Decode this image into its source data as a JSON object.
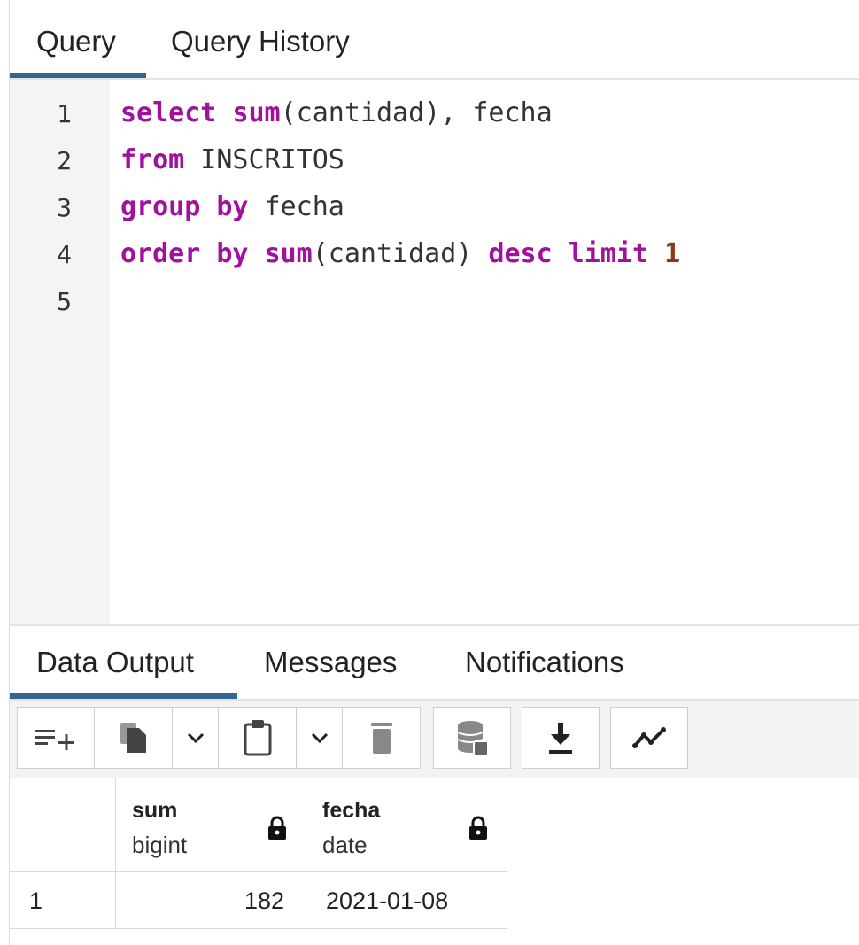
{
  "editor_tabs": [
    {
      "label": "Query",
      "active": true
    },
    {
      "label": "Query History",
      "active": false
    }
  ],
  "editor": {
    "line_numbers": [
      "1",
      "2",
      "3",
      "4",
      "5"
    ],
    "lines": [
      [
        {
          "t": "select",
          "c": "kw"
        },
        {
          "t": " "
        },
        {
          "t": "sum",
          "c": "fn"
        },
        {
          "t": "(cantidad), fecha"
        }
      ],
      [
        {
          "t": "from",
          "c": "kw"
        },
        {
          "t": " INSCRITOS"
        }
      ],
      [
        {
          "t": "group by",
          "c": "kw"
        },
        {
          "t": " fecha"
        }
      ],
      [
        {
          "t": "order by",
          "c": "kw"
        },
        {
          "t": " "
        },
        {
          "t": "sum",
          "c": "fn"
        },
        {
          "t": "(cantidad) "
        },
        {
          "t": "desc limit",
          "c": "kw"
        },
        {
          "t": " "
        },
        {
          "t": "1",
          "c": "num"
        }
      ],
      []
    ]
  },
  "output_tabs": [
    {
      "label": "Data Output",
      "active": true
    },
    {
      "label": "Messages",
      "active": false
    },
    {
      "label": "Notifications",
      "active": false
    }
  ],
  "toolbar": {
    "buttons": [
      "add-row-icon",
      "copy-icon",
      "chevron-down-icon",
      "paste-icon",
      "chevron-down-icon",
      "delete-icon",
      "save-data-icon",
      "download-icon",
      "graph-visualiser-icon"
    ]
  },
  "grid": {
    "columns": [
      {
        "name": "sum",
        "type": "bigint",
        "locked": true
      },
      {
        "name": "fecha",
        "type": "date",
        "locked": true
      }
    ],
    "rows": [
      {
        "num": "1",
        "sum": "182",
        "fecha": "2021-01-08"
      }
    ]
  },
  "colors": {
    "accent": "#326690",
    "keyword": "#a0119d",
    "number": "#8a3a16"
  }
}
